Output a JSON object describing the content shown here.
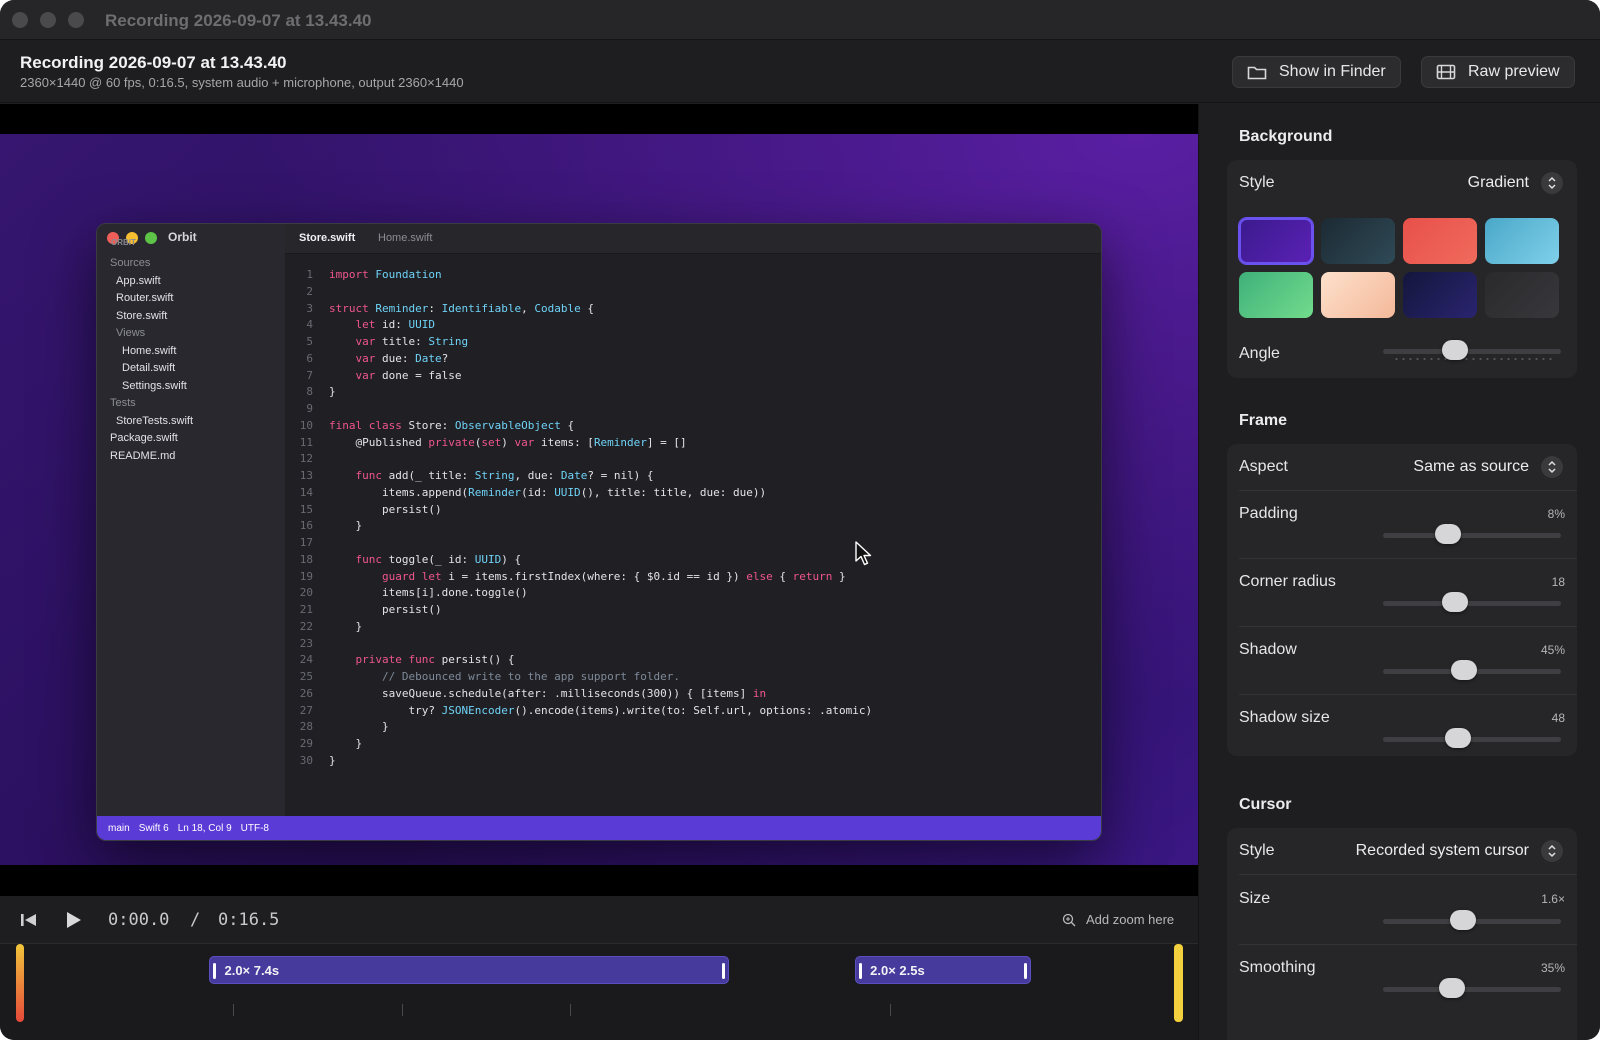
{
  "window": {
    "title": "Recording 2026-09-07 at 13.43.40"
  },
  "header": {
    "title": "Recording 2026-09-07 at 13.43.40",
    "meta": "2360×1440 @ 60 fps, 0:16.5, system audio + microphone, output 2360×1440",
    "show_in_finder": "Show in Finder",
    "raw_preview": "Raw preview"
  },
  "preview": {
    "app_name": "Orbit",
    "ghost_label": "ORBIT",
    "tree": [
      {
        "label": "Sources",
        "group": true,
        "indent": 0
      },
      {
        "label": "App.swift",
        "group": false,
        "indent": 1
      },
      {
        "label": "Router.swift",
        "group": false,
        "indent": 1
      },
      {
        "label": "Store.swift",
        "group": false,
        "indent": 1
      },
      {
        "label": "Views",
        "group": true,
        "indent": 1
      },
      {
        "label": "Home.swift",
        "group": false,
        "indent": 2
      },
      {
        "label": "Detail.swift",
        "group": false,
        "indent": 2
      },
      {
        "label": "Settings.swift",
        "group": false,
        "indent": 2
      },
      {
        "label": "Tests",
        "group": true,
        "indent": 0
      },
      {
        "label": "StoreTests.swift",
        "group": false,
        "indent": 1
      },
      {
        "label": "Package.swift",
        "group": false,
        "indent": 0
      },
      {
        "label": "README.md",
        "group": false,
        "indent": 0
      }
    ],
    "tabs": [
      {
        "label": "Store.swift",
        "active": true
      },
      {
        "label": "Home.swift",
        "active": false
      }
    ],
    "code_lines": [
      "import Foundation",
      "",
      "struct Reminder: Identifiable, Codable {",
      "    let id: UUID",
      "    var title: String",
      "    var due: Date?",
      "    var done = false",
      "}",
      "",
      "final class Store: ObservableObject {",
      "    @Published private(set) var items: [Reminder] = []",
      "",
      "    func add(_ title: String, due: Date? = nil) {",
      "        items.append(Reminder(id: UUID(), title: title, due: due))",
      "        persist()",
      "    }",
      "",
      "    func toggle(_ id: UUID) {",
      "        guard let i = items.firstIndex(where: { $0.id == id }) else { return }",
      "        items[i].done.toggle()",
      "        persist()",
      "    }",
      "",
      "    private func persist() {",
      "        // Debounced write to the app support folder.",
      "        saveQueue.schedule(after: .milliseconds(300)) { [items] in",
      "            try? JSONEncoder().encode(items).write(to: Self.url, options: .atomic)",
      "        }",
      "    }",
      "}"
    ],
    "status": [
      "main",
      "Swift 6",
      "Ln 18, Col 9",
      "UTF-8"
    ]
  },
  "transport": {
    "current_time": "0:00.0",
    "separator": "/",
    "total_time": "0:16.5",
    "add_zoom": "Add zoom here"
  },
  "timeline": {
    "segments": [
      {
        "label": "2.0×  7.4s",
        "zoom": "2.0×",
        "duration_s": 7.4,
        "start_s": 2.7
      },
      {
        "label": "2.0×  2.5s",
        "zoom": "2.0×",
        "duration_s": 2.5,
        "start_s": 11.9
      }
    ],
    "total_s": 16.5,
    "playhead_s": 0
  },
  "inspector": {
    "background": {
      "title": "Background",
      "style_label": "Style",
      "style_value": "Gradient",
      "angle_label": "Angle",
      "angle_level": 0.39,
      "swatches": [
        {
          "name": "purple",
          "from": "#3a1a8c",
          "to": "#5b21b6",
          "selected": true
        },
        {
          "name": "slate",
          "from": "#1c2a33",
          "to": "#2f4a57",
          "selected": false
        },
        {
          "name": "coral",
          "from": "#e8504a",
          "to": "#f06b5c",
          "selected": false
        },
        {
          "name": "sky",
          "from": "#4aa8c8",
          "to": "#7fd0ea",
          "selected": false
        },
        {
          "name": "mint",
          "from": "#3fb07a",
          "to": "#72dc8c",
          "selected": false
        },
        {
          "name": "peach",
          "from": "#fde1cc",
          "to": "#f4b89a",
          "selected": false
        },
        {
          "name": "midnight",
          "from": "#14163c",
          "to": "#2a2470",
          "selected": false
        },
        {
          "name": "graphite",
          "from": "#2a2a2d",
          "to": "#38383c",
          "selected": false
        }
      ],
      "accent": "#6a52f0"
    },
    "frame": {
      "title": "Frame",
      "aspect_label": "Aspect",
      "aspect_value": "Same as source",
      "padding_label": "Padding",
      "padding_value": "8%",
      "padding_level": 0.34,
      "radius_label": "Corner radius",
      "radius_value": "18",
      "radius_level": 0.39,
      "shadow_label": "Shadow",
      "shadow_value": "45%",
      "shadow_level": 0.45,
      "shadow_size_label": "Shadow size",
      "shadow_size_value": "48",
      "shadow_size_level": 0.41
    },
    "cursor": {
      "title": "Cursor",
      "style_label": "Style",
      "style_value": "Recorded system cursor",
      "size_label": "Size",
      "size_value": "1.6×",
      "size_level": 0.44,
      "smoothing_label": "Smoothing",
      "smoothing_value": "35%",
      "smoothing_level": 0.37
    }
  }
}
